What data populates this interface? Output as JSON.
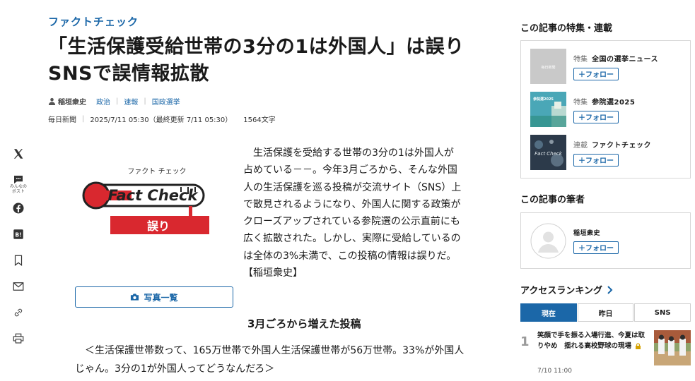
{
  "article": {
    "eyebrow": "ファクトチェック",
    "title_line1": "「生活保護受給世帯の3分の1は外国人」は誤り",
    "title_line2": "SNSで誤情報拡散",
    "author": "稲垣衆史",
    "categories": [
      "政治",
      "速報",
      "国政選挙"
    ],
    "publisher": "毎日新聞",
    "published": "2025/7/11 05:30（最終更新 7/11 05:30）",
    "char_count": "1564文字",
    "photo_button": "写真一覧",
    "photo": {
      "label_small": "ファクト チェック",
      "label_big": "Fact Check",
      "verdict": "誤り"
    },
    "lead": "生活保護を受給する世帯の3分の1は外国人が占めている－－。今年3月ごろから、そんな外国人の生活保護を巡る投稿が交流サイト（SNS）上で散見されるようになり、外国人に関する政策がクローズアップされている参院選の公示直前にも広く拡散された。しかし、実際に受給しているのは全体の3%未満で、この投稿の情報は誤りだ。【稲垣衆史】",
    "subhead": "3月ごろから増えた投稿",
    "quote": "＜生活保護世帯数って、165万世帯で外国人生活保護世帯が56万世帯。33%が外国人じゃん。3分の1が外国人ってどうなんだろ＞"
  },
  "share": {
    "x_icon": "x-icon",
    "comment_label": "みんなの\nポスト",
    "icons": [
      "x-icon",
      "comment-icon",
      "facebook-icon",
      "hatena-icon",
      "bookmark-icon",
      "mail-icon",
      "link-icon",
      "print-icon"
    ]
  },
  "sidebar": {
    "features_heading": "この記事の特集・連載",
    "features": [
      {
        "kind": "特集",
        "name": "全国の選挙ニュース",
        "follow": "＋フォロー",
        "thumb_text": "毎日新聞"
      },
      {
        "kind": "特集",
        "name": "参院選2025",
        "follow": "＋フォロー",
        "thumb_text": "参院選2025"
      },
      {
        "kind": "連載",
        "name": "ファクトチェック",
        "follow": "＋フォロー",
        "thumb_text": "Fact Check"
      }
    ],
    "writer_heading": "この記事の筆者",
    "writer": {
      "name": "稲垣衆史",
      "follow": "＋フォロー"
    },
    "ranking_heading": "アクセスランキング",
    "ranking_tabs": [
      "現在",
      "昨日",
      "SNS"
    ],
    "ranking_items": [
      {
        "rank": "1",
        "title": "笑顔で手を振る入場行進、今夏は取りやめ　揺れる高校野球の現場",
        "date": "7/10 11:00"
      }
    ]
  },
  "colors": {
    "accent": "#1b67a8",
    "factcheck_red": "#d9282f",
    "border": "#d7d7d7"
  }
}
